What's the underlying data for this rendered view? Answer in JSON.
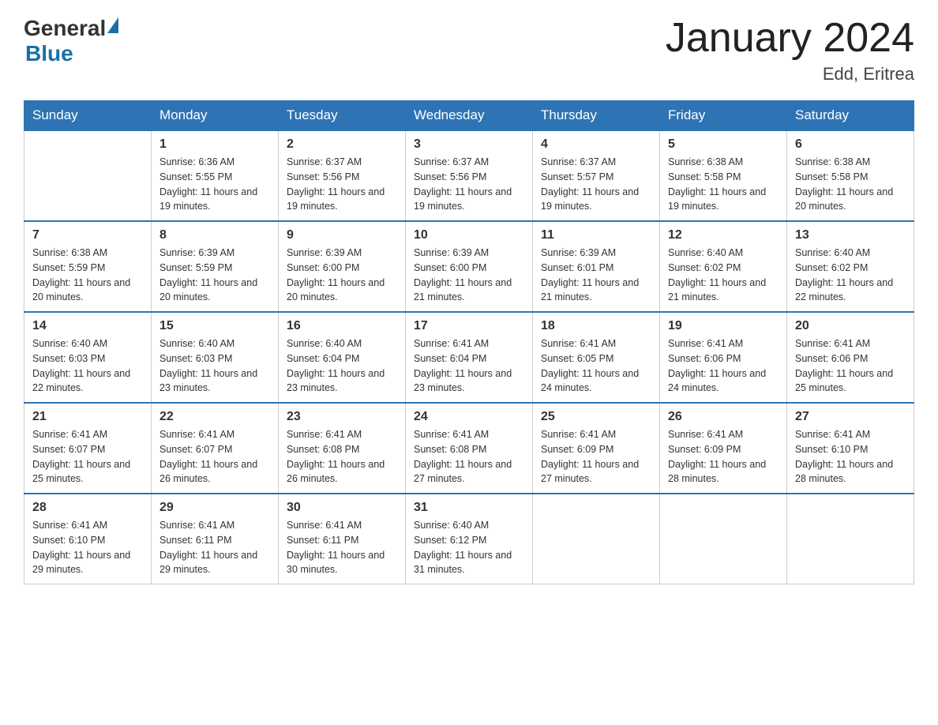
{
  "header": {
    "logo": {
      "general": "General",
      "blue": "Blue"
    },
    "title": "January 2024",
    "location": "Edd, Eritrea"
  },
  "days_of_week": [
    "Sunday",
    "Monday",
    "Tuesday",
    "Wednesday",
    "Thursday",
    "Friday",
    "Saturday"
  ],
  "weeks": [
    [
      {
        "day": "",
        "sunrise": "",
        "sunset": "",
        "daylight": ""
      },
      {
        "day": "1",
        "sunrise": "Sunrise: 6:36 AM",
        "sunset": "Sunset: 5:55 PM",
        "daylight": "Daylight: 11 hours and 19 minutes."
      },
      {
        "day": "2",
        "sunrise": "Sunrise: 6:37 AM",
        "sunset": "Sunset: 5:56 PM",
        "daylight": "Daylight: 11 hours and 19 minutes."
      },
      {
        "day": "3",
        "sunrise": "Sunrise: 6:37 AM",
        "sunset": "Sunset: 5:56 PM",
        "daylight": "Daylight: 11 hours and 19 minutes."
      },
      {
        "day": "4",
        "sunrise": "Sunrise: 6:37 AM",
        "sunset": "Sunset: 5:57 PM",
        "daylight": "Daylight: 11 hours and 19 minutes."
      },
      {
        "day": "5",
        "sunrise": "Sunrise: 6:38 AM",
        "sunset": "Sunset: 5:58 PM",
        "daylight": "Daylight: 11 hours and 19 minutes."
      },
      {
        "day": "6",
        "sunrise": "Sunrise: 6:38 AM",
        "sunset": "Sunset: 5:58 PM",
        "daylight": "Daylight: 11 hours and 20 minutes."
      }
    ],
    [
      {
        "day": "7",
        "sunrise": "Sunrise: 6:38 AM",
        "sunset": "Sunset: 5:59 PM",
        "daylight": "Daylight: 11 hours and 20 minutes."
      },
      {
        "day": "8",
        "sunrise": "Sunrise: 6:39 AM",
        "sunset": "Sunset: 5:59 PM",
        "daylight": "Daylight: 11 hours and 20 minutes."
      },
      {
        "day": "9",
        "sunrise": "Sunrise: 6:39 AM",
        "sunset": "Sunset: 6:00 PM",
        "daylight": "Daylight: 11 hours and 20 minutes."
      },
      {
        "day": "10",
        "sunrise": "Sunrise: 6:39 AM",
        "sunset": "Sunset: 6:00 PM",
        "daylight": "Daylight: 11 hours and 21 minutes."
      },
      {
        "day": "11",
        "sunrise": "Sunrise: 6:39 AM",
        "sunset": "Sunset: 6:01 PM",
        "daylight": "Daylight: 11 hours and 21 minutes."
      },
      {
        "day": "12",
        "sunrise": "Sunrise: 6:40 AM",
        "sunset": "Sunset: 6:02 PM",
        "daylight": "Daylight: 11 hours and 21 minutes."
      },
      {
        "day": "13",
        "sunrise": "Sunrise: 6:40 AM",
        "sunset": "Sunset: 6:02 PM",
        "daylight": "Daylight: 11 hours and 22 minutes."
      }
    ],
    [
      {
        "day": "14",
        "sunrise": "Sunrise: 6:40 AM",
        "sunset": "Sunset: 6:03 PM",
        "daylight": "Daylight: 11 hours and 22 minutes."
      },
      {
        "day": "15",
        "sunrise": "Sunrise: 6:40 AM",
        "sunset": "Sunset: 6:03 PM",
        "daylight": "Daylight: 11 hours and 23 minutes."
      },
      {
        "day": "16",
        "sunrise": "Sunrise: 6:40 AM",
        "sunset": "Sunset: 6:04 PM",
        "daylight": "Daylight: 11 hours and 23 minutes."
      },
      {
        "day": "17",
        "sunrise": "Sunrise: 6:41 AM",
        "sunset": "Sunset: 6:04 PM",
        "daylight": "Daylight: 11 hours and 23 minutes."
      },
      {
        "day": "18",
        "sunrise": "Sunrise: 6:41 AM",
        "sunset": "Sunset: 6:05 PM",
        "daylight": "Daylight: 11 hours and 24 minutes."
      },
      {
        "day": "19",
        "sunrise": "Sunrise: 6:41 AM",
        "sunset": "Sunset: 6:06 PM",
        "daylight": "Daylight: 11 hours and 24 minutes."
      },
      {
        "day": "20",
        "sunrise": "Sunrise: 6:41 AM",
        "sunset": "Sunset: 6:06 PM",
        "daylight": "Daylight: 11 hours and 25 minutes."
      }
    ],
    [
      {
        "day": "21",
        "sunrise": "Sunrise: 6:41 AM",
        "sunset": "Sunset: 6:07 PM",
        "daylight": "Daylight: 11 hours and 25 minutes."
      },
      {
        "day": "22",
        "sunrise": "Sunrise: 6:41 AM",
        "sunset": "Sunset: 6:07 PM",
        "daylight": "Daylight: 11 hours and 26 minutes."
      },
      {
        "day": "23",
        "sunrise": "Sunrise: 6:41 AM",
        "sunset": "Sunset: 6:08 PM",
        "daylight": "Daylight: 11 hours and 26 minutes."
      },
      {
        "day": "24",
        "sunrise": "Sunrise: 6:41 AM",
        "sunset": "Sunset: 6:08 PM",
        "daylight": "Daylight: 11 hours and 27 minutes."
      },
      {
        "day": "25",
        "sunrise": "Sunrise: 6:41 AM",
        "sunset": "Sunset: 6:09 PM",
        "daylight": "Daylight: 11 hours and 27 minutes."
      },
      {
        "day": "26",
        "sunrise": "Sunrise: 6:41 AM",
        "sunset": "Sunset: 6:09 PM",
        "daylight": "Daylight: 11 hours and 28 minutes."
      },
      {
        "day": "27",
        "sunrise": "Sunrise: 6:41 AM",
        "sunset": "Sunset: 6:10 PM",
        "daylight": "Daylight: 11 hours and 28 minutes."
      }
    ],
    [
      {
        "day": "28",
        "sunrise": "Sunrise: 6:41 AM",
        "sunset": "Sunset: 6:10 PM",
        "daylight": "Daylight: 11 hours and 29 minutes."
      },
      {
        "day": "29",
        "sunrise": "Sunrise: 6:41 AM",
        "sunset": "Sunset: 6:11 PM",
        "daylight": "Daylight: 11 hours and 29 minutes."
      },
      {
        "day": "30",
        "sunrise": "Sunrise: 6:41 AM",
        "sunset": "Sunset: 6:11 PM",
        "daylight": "Daylight: 11 hours and 30 minutes."
      },
      {
        "day": "31",
        "sunrise": "Sunrise: 6:40 AM",
        "sunset": "Sunset: 6:12 PM",
        "daylight": "Daylight: 11 hours and 31 minutes."
      },
      {
        "day": "",
        "sunrise": "",
        "sunset": "",
        "daylight": ""
      },
      {
        "day": "",
        "sunrise": "",
        "sunset": "",
        "daylight": ""
      },
      {
        "day": "",
        "sunrise": "",
        "sunset": "",
        "daylight": ""
      }
    ]
  ]
}
